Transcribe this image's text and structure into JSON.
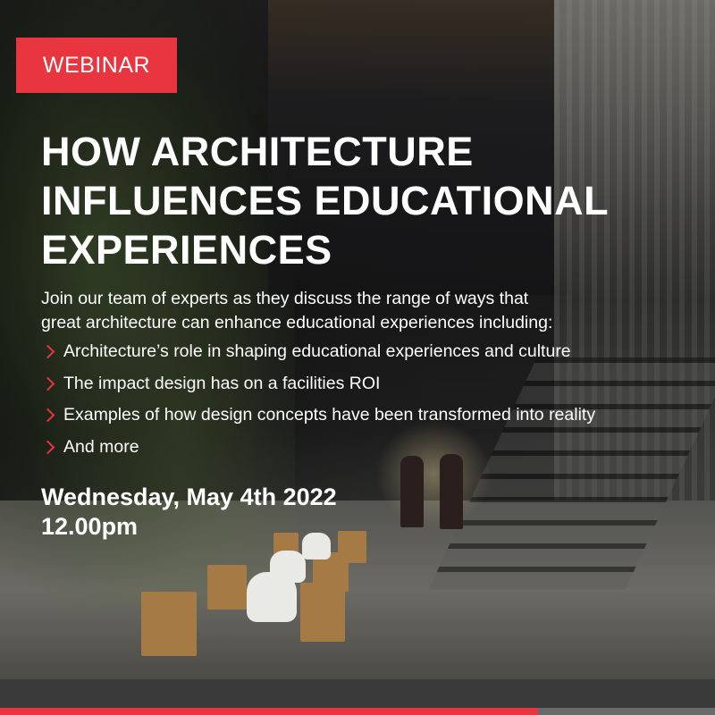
{
  "badge": {
    "label": "WEBINAR"
  },
  "title": {
    "lines": [
      "HOW ARCHITECTURE",
      "INFLUENCES EDUCATIONAL",
      "EXPERIENCES"
    ]
  },
  "intro": {
    "lines": [
      "Join our team of experts as they discuss the range of ways that",
      "great architecture can enhance educational experiences including:"
    ]
  },
  "bullets": [
    "Architecture’s role in shaping educational experiences and culture",
    "The impact design has on a facilities ROI",
    "Examples of how design concepts have been transformed into reality",
    "And more"
  ],
  "event": {
    "date": "Wednesday, May 4th 2022",
    "time": "12.00pm"
  },
  "colors": {
    "accent": "#e8353f",
    "text": "#ffffff",
    "bottom_bar": "#3a3a3a"
  },
  "icons": {
    "bullet": "chevron-right-icon"
  }
}
